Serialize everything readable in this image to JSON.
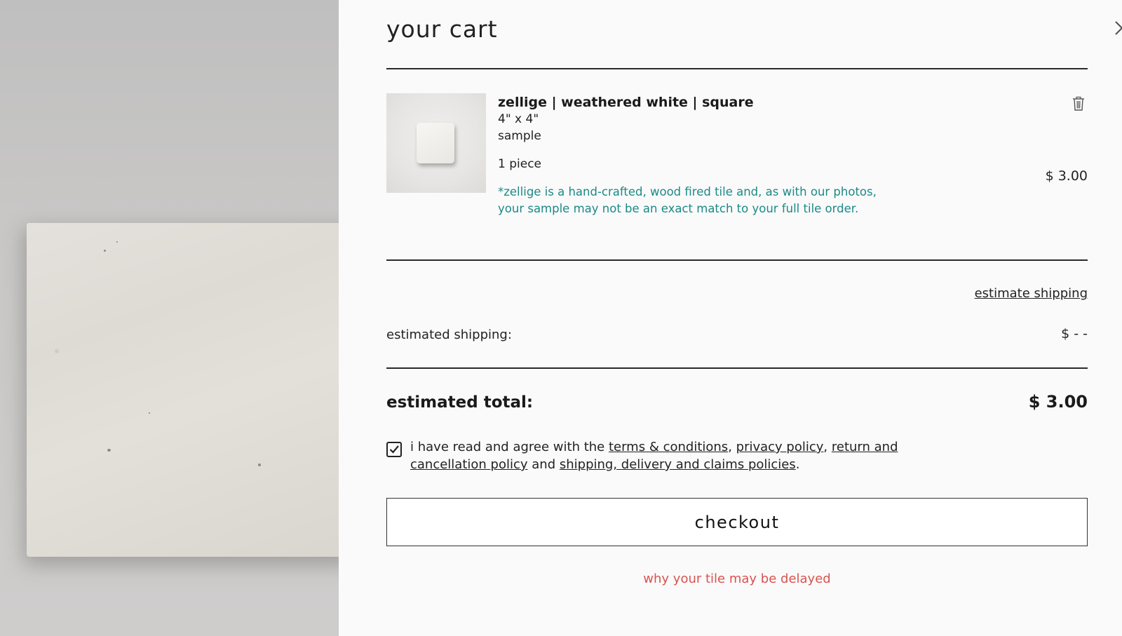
{
  "cart": {
    "title": "your cart",
    "close_icon": "close-icon",
    "trash_icon": "trash-icon",
    "item": {
      "name": "zellige | weathered white | square",
      "size": "4\" x 4\"",
      "type": "sample",
      "quantity": "1 piece",
      "note": "*zellige is a hand-crafted, wood fired tile and, as with our photos, your sample may not be an exact match to your full tile order.",
      "price": "$ 3.00"
    },
    "shipping": {
      "estimate_link": "estimate shipping",
      "label": "estimated shipping:",
      "value": "$ - -"
    },
    "total": {
      "label": "estimated total:",
      "value": "$ 3.00"
    },
    "agreement": {
      "checked": true,
      "prefix": "i have read and agree with the",
      "terms": "terms & conditions",
      "privacy": "privacy policy",
      "returns": "return and cancellation policy",
      "and": "and",
      "shipping": "shipping, delivery and claims policies",
      "suffix": "."
    },
    "checkout_label": "checkout",
    "delay_link": "why your tile may be delayed"
  },
  "colors": {
    "note": "#1b8a86",
    "delay": "#d9534f",
    "background": "#fafafa"
  }
}
